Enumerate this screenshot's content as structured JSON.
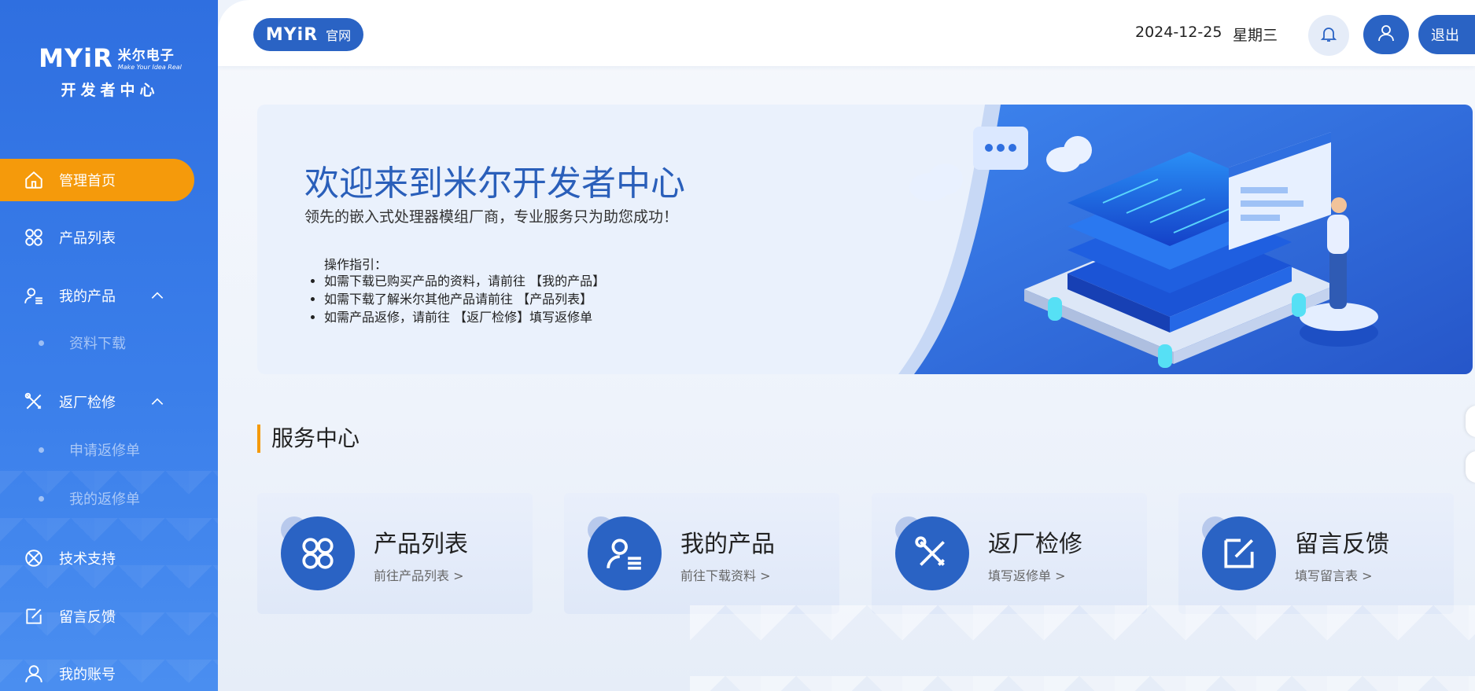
{
  "sidebar": {
    "logo": {
      "brand": "MYiR",
      "cn_name": "米尔电子",
      "slogan": "Make Your Idea Real",
      "subtitle": "开发者中心"
    },
    "items": [
      {
        "label": "管理首页",
        "icon": "home-icon",
        "active": true
      },
      {
        "label": "产品列表",
        "icon": "grid-icon"
      },
      {
        "label": "我的产品",
        "icon": "user-list-icon",
        "expanded": true
      },
      {
        "label": "资料下载",
        "sub": true
      },
      {
        "label": "返厂检修",
        "icon": "tools-icon",
        "expanded": true
      },
      {
        "label": "申请返修单",
        "sub": true
      },
      {
        "label": "我的返修单",
        "sub": true
      },
      {
        "label": "技术支持",
        "icon": "support-icon"
      },
      {
        "label": "留言反馈",
        "icon": "edit-icon"
      },
      {
        "label": "我的账号",
        "icon": "user-icon"
      }
    ]
  },
  "header": {
    "site_brand": "MYiR",
    "site_label": "官网",
    "date": "2024-12-25",
    "weekday": "星期三",
    "logout": "退出"
  },
  "banner": {
    "title": "欢迎来到米尔开发者中心",
    "subtitle": "领先的嵌入式处理器模组厂商，专业服务只为助您成功！",
    "guide_title": "操作指引：",
    "guide": [
      "如需下载已购买产品的资料，请前往 【我的产品】",
      "如需下载了解米尔其他产品请前往 【产品列表】",
      "如需产品返修，请前往 【返厂检修】填写返修单"
    ]
  },
  "service": {
    "title": "服务中心",
    "cards": [
      {
        "title": "产品列表",
        "link": "前往产品列表 >",
        "icon": "grid-icon"
      },
      {
        "title": "我的产品",
        "link": "前往下载资料 >",
        "icon": "user-list-icon"
      },
      {
        "title": "返厂检修",
        "link": "填写返修单 >",
        "icon": "tools-icon"
      },
      {
        "title": "留言反馈",
        "link": "填写留言表 >",
        "icon": "edit-icon"
      }
    ]
  },
  "colors": {
    "primary": "#2a63c4",
    "accent": "#f59a0b",
    "sidebar": "#3a7eea"
  }
}
